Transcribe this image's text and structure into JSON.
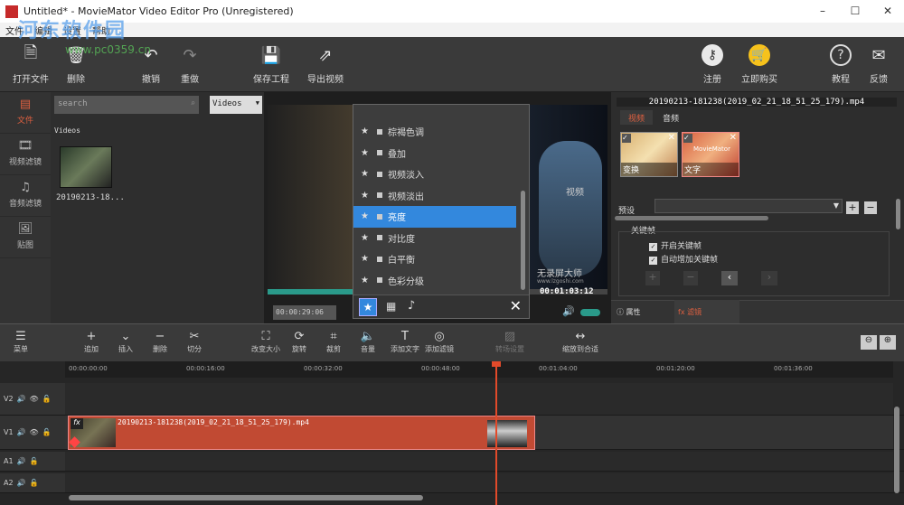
{
  "window": {
    "title": "Untitled* - MovieMator Video Editor Pro (Unregistered)",
    "minimize": "–",
    "maximize": "☐",
    "close": "✕"
  },
  "menu": [
    "文件",
    "编辑",
    "设置",
    "帮助"
  ],
  "watermark": {
    "line1": "河东软件园",
    "line2": "www.pc0359.cn"
  },
  "toolbar": {
    "open": "打开文件",
    "delete": "删除",
    "undo": "撤销",
    "redo": "重做",
    "save": "保存工程",
    "export": "导出视频",
    "register": "注册",
    "buy": "立即购买",
    "tutorial": "教程",
    "feedback": "反馈"
  },
  "sidebar": [
    "文件",
    "视频滤镜",
    "音频滤镜",
    "贴图"
  ],
  "media": {
    "search_placeholder": "search",
    "type": "Videos",
    "section": "Videos",
    "clip_name": "20190213-18..."
  },
  "preview": {
    "time_current": "00:00:29:06",
    "time_total": "00:01:03:12",
    "watermark1": "视频",
    "watermark2": "无录屏大师",
    "watermark3": "www.lzgoshi.com"
  },
  "filters": {
    "items": [
      "棕褐色调",
      "叠加",
      "视频淡入",
      "视频淡出",
      "亮度",
      "对比度",
      "白平衡",
      "色彩分级"
    ],
    "selected_index": 4,
    "close": "✕"
  },
  "properties": {
    "filename": "20190213-181238(2019_02_21_18_51_25_179).mp4",
    "tab_video": "视频",
    "tab_audio": "音频",
    "thumb1": "变换",
    "thumb2": "文字",
    "thumb2_overlay": "MovieMator",
    "preset_label": "预设",
    "keyframe_section": "关键帧",
    "keyframe_enable": "开启关键帧",
    "keyframe_auto": "自动增加关键帧",
    "tab_props": "属性",
    "tab_filters": "滤镜"
  },
  "timeline_toolbar": {
    "menu": "菜单",
    "add": "追加",
    "insert": "插入",
    "remove": "删除",
    "split": "切分",
    "resize": "改变大小",
    "rotate": "旋转",
    "crop": "裁剪",
    "volume": "音量",
    "add_text": "添加文字",
    "add_filter": "添加滤镜",
    "transition": "转场设置",
    "zoom_fit": "缩放到合适"
  },
  "ruler": [
    "00:00:00:00",
    "00:00:16:00",
    "00:00:32:00",
    "00:00:48:00",
    "00:01:04:00",
    "00:01:20:00",
    "00:01:36:00"
  ],
  "tracks": [
    "V2",
    "V1",
    "A1",
    "A2"
  ],
  "clip": {
    "fx": "fx",
    "label": "20190213-181238(2019_02_21_18_51_25_179).mp4"
  },
  "colors": {
    "accent": "#3388dd",
    "clip": "#c14a33",
    "brand": "#e06040"
  },
  "playhead_fraction": 0.52
}
